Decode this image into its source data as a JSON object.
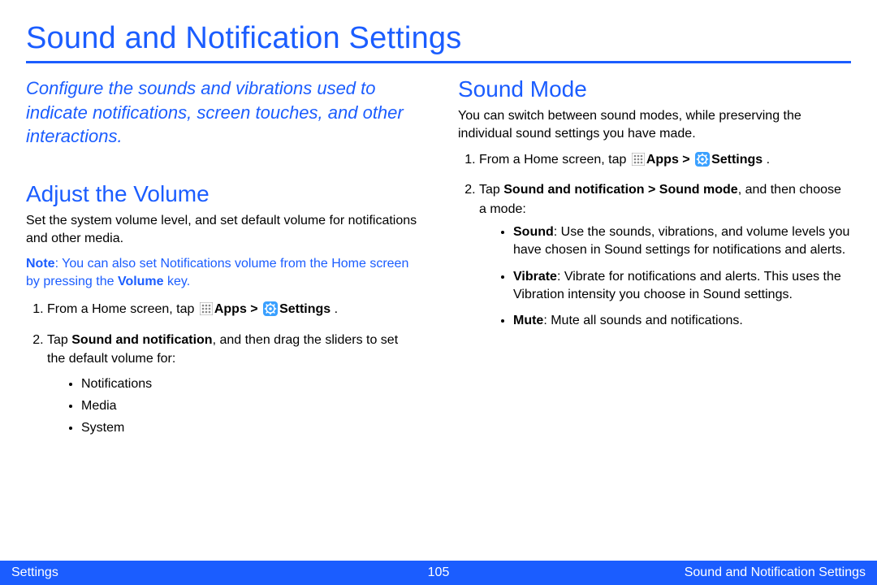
{
  "title": "Sound and Notification Settings",
  "intro": "Configure the sounds and vibrations used to indicate notifications, screen touches, and other interactions.",
  "left": {
    "heading": "Adjust the Volume",
    "body": "Set the system volume level, and set default volume for notifications and other media.",
    "note_prefix": "Note",
    "note_text1": ": You can also set Notifications volume from the Home screen by pressing the ",
    "note_bold": "Volume",
    "note_text2": " key.",
    "step1_pre": "From a Home screen, tap ",
    "apps_label": "Apps > ",
    "settings_label": "Settings",
    "step1_post": " .",
    "step2_pre": "Tap ",
    "step2_bold": "Sound and notification",
    "step2_post": ", and then drag the sliders to set the default volume for:",
    "bullets": {
      "0": "Notifications",
      "1": "Media",
      "2": "System"
    }
  },
  "right": {
    "heading": "Sound Mode",
    "body": "You can switch between sound modes, while preserving the individual sound settings you have made.",
    "step1_pre": "From a Home screen, tap ",
    "apps_label": "Apps > ",
    "settings_label": "Settings",
    "step1_post": " .",
    "step2_pre": "Tap ",
    "step2_bold": "Sound and notification > Sound mode",
    "step2_post": ", and then choose a mode:",
    "bullets": {
      "0": {
        "label": "Sound",
        "text": ": Use the sounds, vibrations, and volume levels you have chosen in Sound settings for notifications and alerts."
      },
      "1": {
        "label": "Vibrate",
        "text": ": Vibrate for notifications and alerts. This uses the Vibration intensity you choose in Sound settings."
      },
      "2": {
        "label": "Mute",
        "text": ": Mute all sounds and notifications."
      }
    }
  },
  "footer": {
    "left": "Settings",
    "center": "105",
    "right": "Sound and Notification Settings"
  }
}
